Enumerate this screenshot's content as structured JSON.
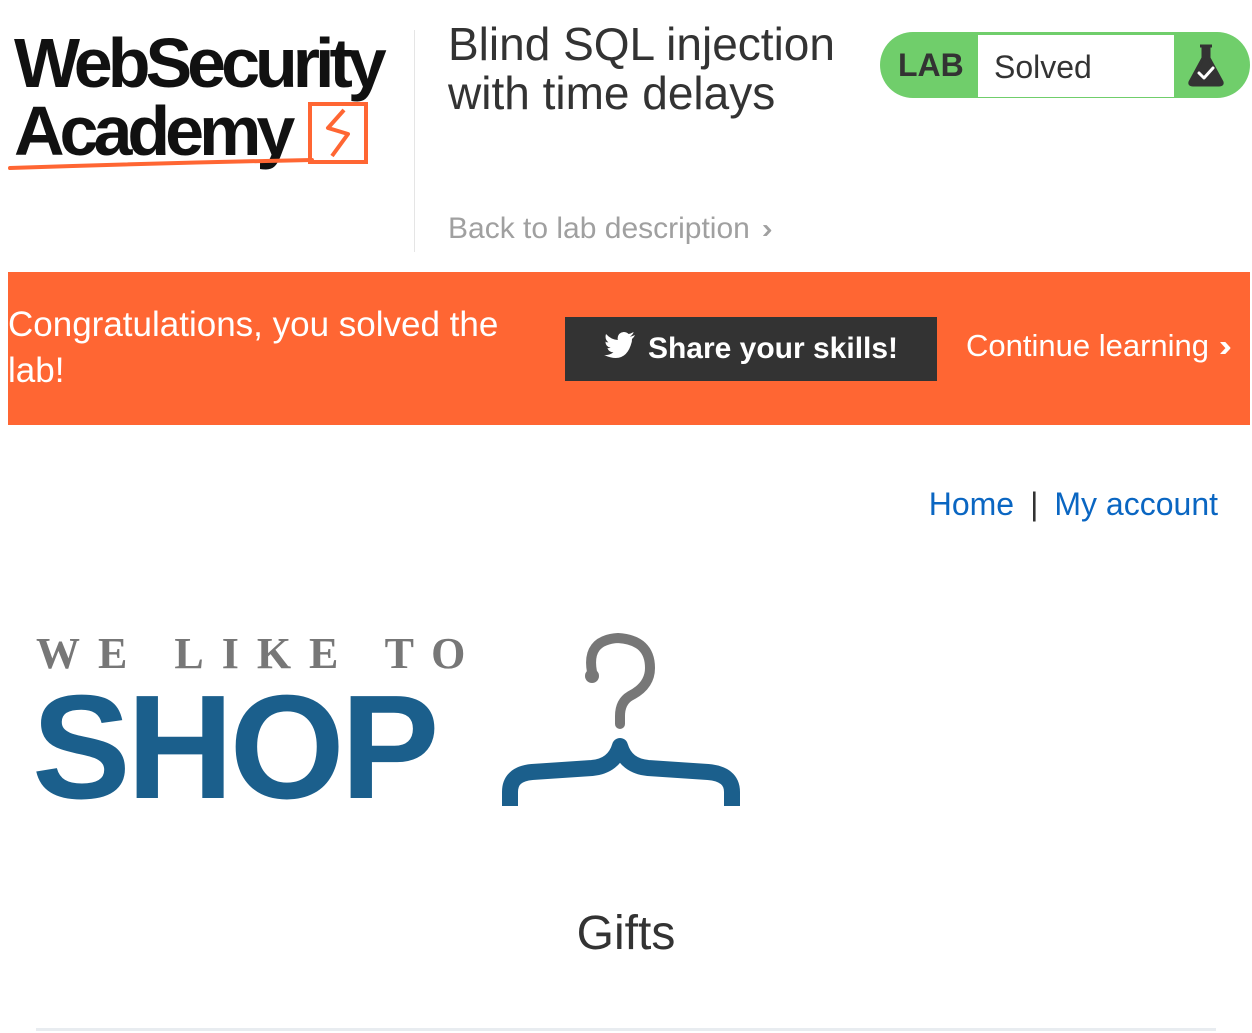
{
  "academy_logo": {
    "line1": "WebSecurity",
    "line2": "Academy"
  },
  "lab": {
    "title": "Blind SQL injection with time delays",
    "back_link": "Back to lab description",
    "status_tag": "LAB",
    "status_text": "Solved",
    "status_color": "#70ce6b"
  },
  "banner": {
    "message": "Congratulations, you solved the lab!",
    "share_label": "Share your skills!",
    "continue_label": "Continue learning",
    "color": "#ff6633"
  },
  "nav": {
    "home": "Home",
    "separator": "|",
    "my_account": "My account"
  },
  "shop_logo": {
    "tagline": "WE LIKE TO",
    "word": "SHOP",
    "brand_color": "#1b5f8c"
  },
  "main": {
    "section_title": "Gifts"
  },
  "icons": {
    "academy": "lightning-bolt-icon",
    "flask": "flask-icon",
    "twitter": "twitter-bird-icon",
    "chevron": "double-chevron-right-icon",
    "hanger": "coat-hanger-icon"
  }
}
